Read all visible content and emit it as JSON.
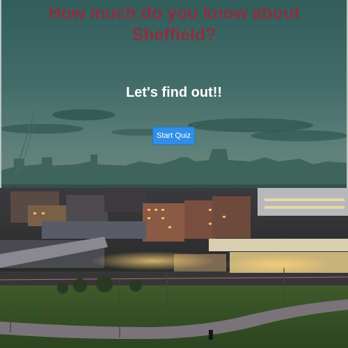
{
  "page": {
    "title_line1": "How much do you know about",
    "title_line2": "Sheffield?",
    "subtitle": "Let's find out!!",
    "start_button_label": "Start Quiz"
  },
  "colors": {
    "title": "#8a3040",
    "subtitle": "#ffffff",
    "button": "#2f8fe6",
    "overlay": "rgba(40,110,80,0.45)"
  }
}
